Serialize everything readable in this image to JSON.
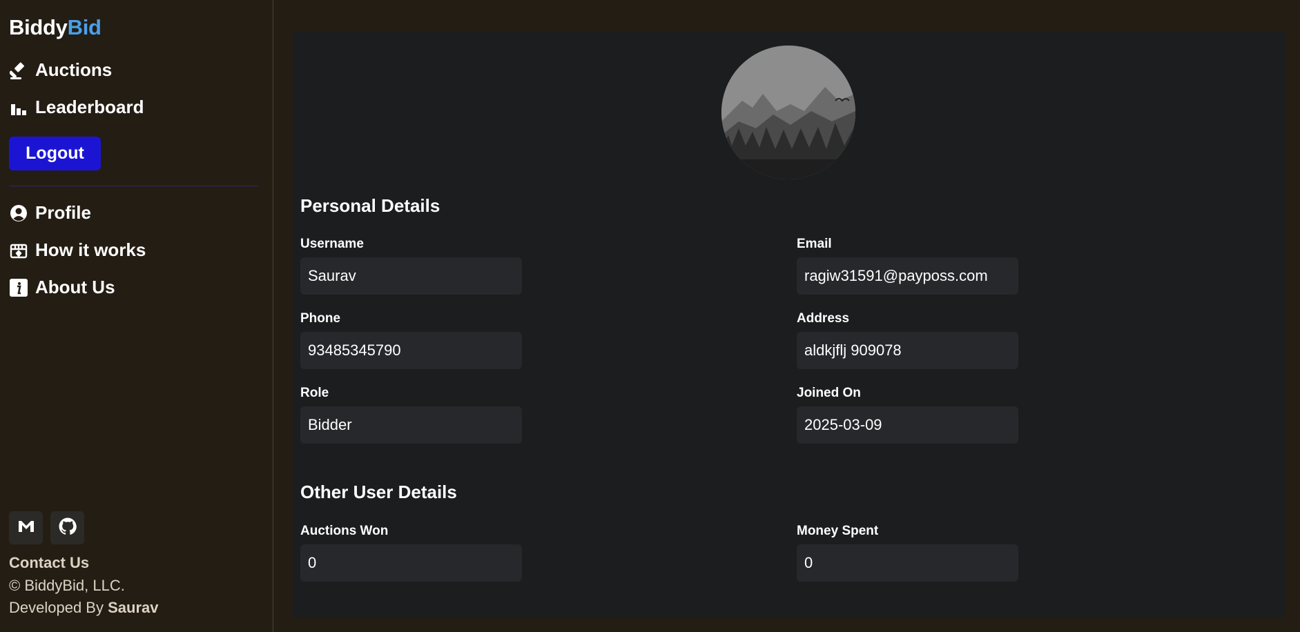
{
  "brand": {
    "part1": "Biddy",
    "part2": "Bid",
    "accent_color": "#4aa0ea"
  },
  "nav": {
    "auctions": {
      "label": "Auctions",
      "icon": "gavel-icon"
    },
    "leaderboard": {
      "label": "Leaderboard",
      "icon": "bar-chart-icon"
    },
    "logout": {
      "label": "Logout",
      "color": "#1b15d3"
    },
    "profile": {
      "label": "Profile",
      "icon": "user-circle-icon"
    },
    "how_it_works": {
      "label": "How it works",
      "icon": "shop-icon"
    },
    "about": {
      "label": "About Us",
      "icon": "info-icon"
    }
  },
  "footer": {
    "social": [
      "gmail-icon",
      "github-icon"
    ],
    "contact": "Contact Us",
    "copyright": "© BiddyBid, LLC.",
    "developed_prefix": "Developed By",
    "developer": "Saurav"
  },
  "profile": {
    "personal_title": "Personal Details",
    "username": {
      "label": "Username",
      "value": "Saurav"
    },
    "email": {
      "label": "Email",
      "value": "ragiw31591@payposs.com"
    },
    "phone": {
      "label": "Phone",
      "value": "93485345790"
    },
    "address": {
      "label": "Address",
      "value": "aldkjflj 909078"
    },
    "role": {
      "label": "Role",
      "value": "Bidder"
    },
    "joined": {
      "label": "Joined On",
      "value": "2025-03-09"
    },
    "other_title": "Other User Details",
    "auctions_won": {
      "label": "Auctions Won",
      "value": "0"
    },
    "money_spent": {
      "label": "Money Spent",
      "value": "0"
    }
  }
}
